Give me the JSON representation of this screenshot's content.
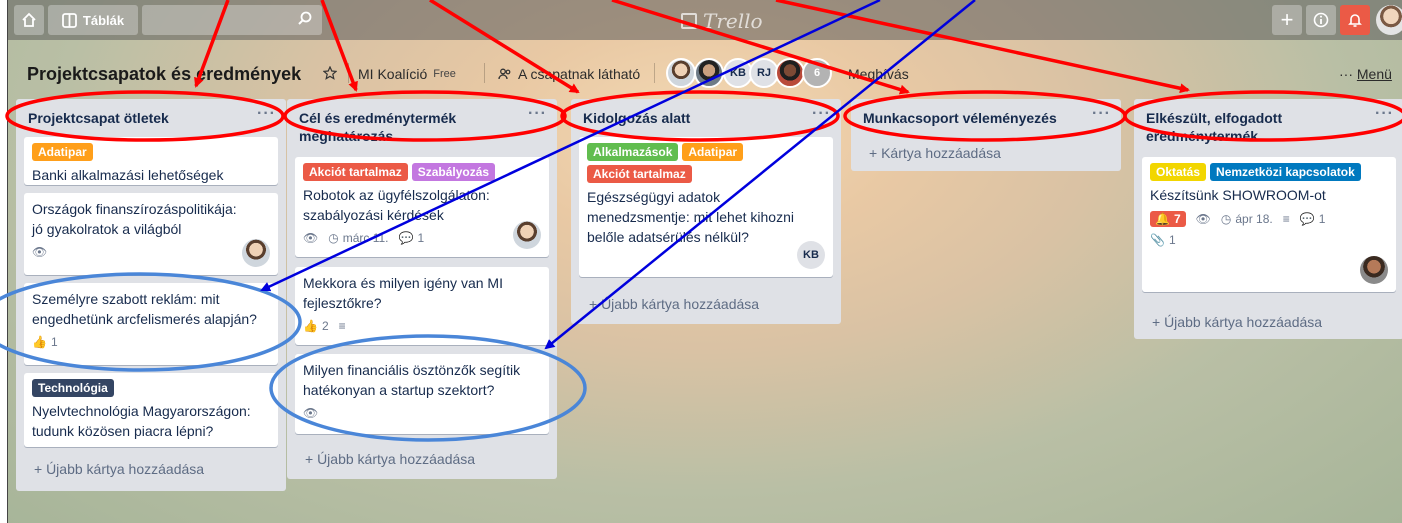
{
  "topbar": {
    "boards_label": "Táblák",
    "search_value": "",
    "logo_text": "Trello"
  },
  "board": {
    "title": "Projektcsapatok és eredmények",
    "team": "MI Koalíció",
    "plan": "Free",
    "visibility": "A csapatnak látható",
    "members": [
      "KB",
      "RJ"
    ],
    "extra_members": "6",
    "invite": "Meghívás",
    "menu_dots": "···",
    "menu": "Menü"
  },
  "lists": [
    {
      "title": "Projektcsapat ötletek",
      "cards": [
        {
          "labels": [
            "Adatipar"
          ],
          "title": "Banki alkalmazási lehetőségek"
        },
        {
          "title": "Országok finanszírozáspolitikája: jó gyakolratok a világból"
        },
        {
          "title": "Személyre szabott reklám: mit engedhetünk arcfelismerés alapján?",
          "likes": "1"
        },
        {
          "labels": [
            "Technológia"
          ],
          "title": "Nyelvtechnológia Magyarországon: tudunk közösen piacra lépni?"
        }
      ],
      "add": "+ Újabb kártya hozzáadása"
    },
    {
      "title": "Cél és eredménytermék meghatározás",
      "cards": [
        {
          "labels": [
            "Akciót tartalmaz",
            "Szabályozás"
          ],
          "title": "Robotok az ügyfélszolgálaton: szabályozási kérdések",
          "due": "márc 11.",
          "comments": "1"
        },
        {
          "title": "Mekkora és milyen igény van MI fejlesztőkre?",
          "likes": "2"
        },
        {
          "title": "Milyen financiális ösztönzők segítik hatékonyan a startup szektort?"
        }
      ],
      "add": "+ Újabb kártya hozzáadása"
    },
    {
      "title": "Kidolgozás alatt",
      "cards": [
        {
          "labels": [
            "Alkalmazások",
            "Adatipar",
            "Akciót tartalmaz"
          ],
          "title": "Egészségügyi adatok menedzsmentje: mit lehet kihozni belőle adatsérülés nélkül?",
          "member": "KB"
        }
      ],
      "add": "+ Újabb kártya hozzáadása"
    },
    {
      "title": "Munkacsoport véleményezés",
      "cards": [],
      "add": "+ Kártya hozzáadása"
    },
    {
      "title": "Elkészült, elfogadott eredménytermék",
      "cards": [
        {
          "labels": [
            "Oktatás",
            "Nemzetközi kapcsolatok"
          ],
          "title": "Készítsünk SHOWROOM-ot",
          "notifications": "7",
          "due": "ápr 18.",
          "comments": "1",
          "attachments": "1"
        }
      ],
      "add": "+ Újabb kártya hozzáadása"
    }
  ],
  "colors": {
    "annotation_red": "#ff0000",
    "annotation_blue": "#0000dd",
    "highlight_ellipse": "#4a86d8"
  }
}
